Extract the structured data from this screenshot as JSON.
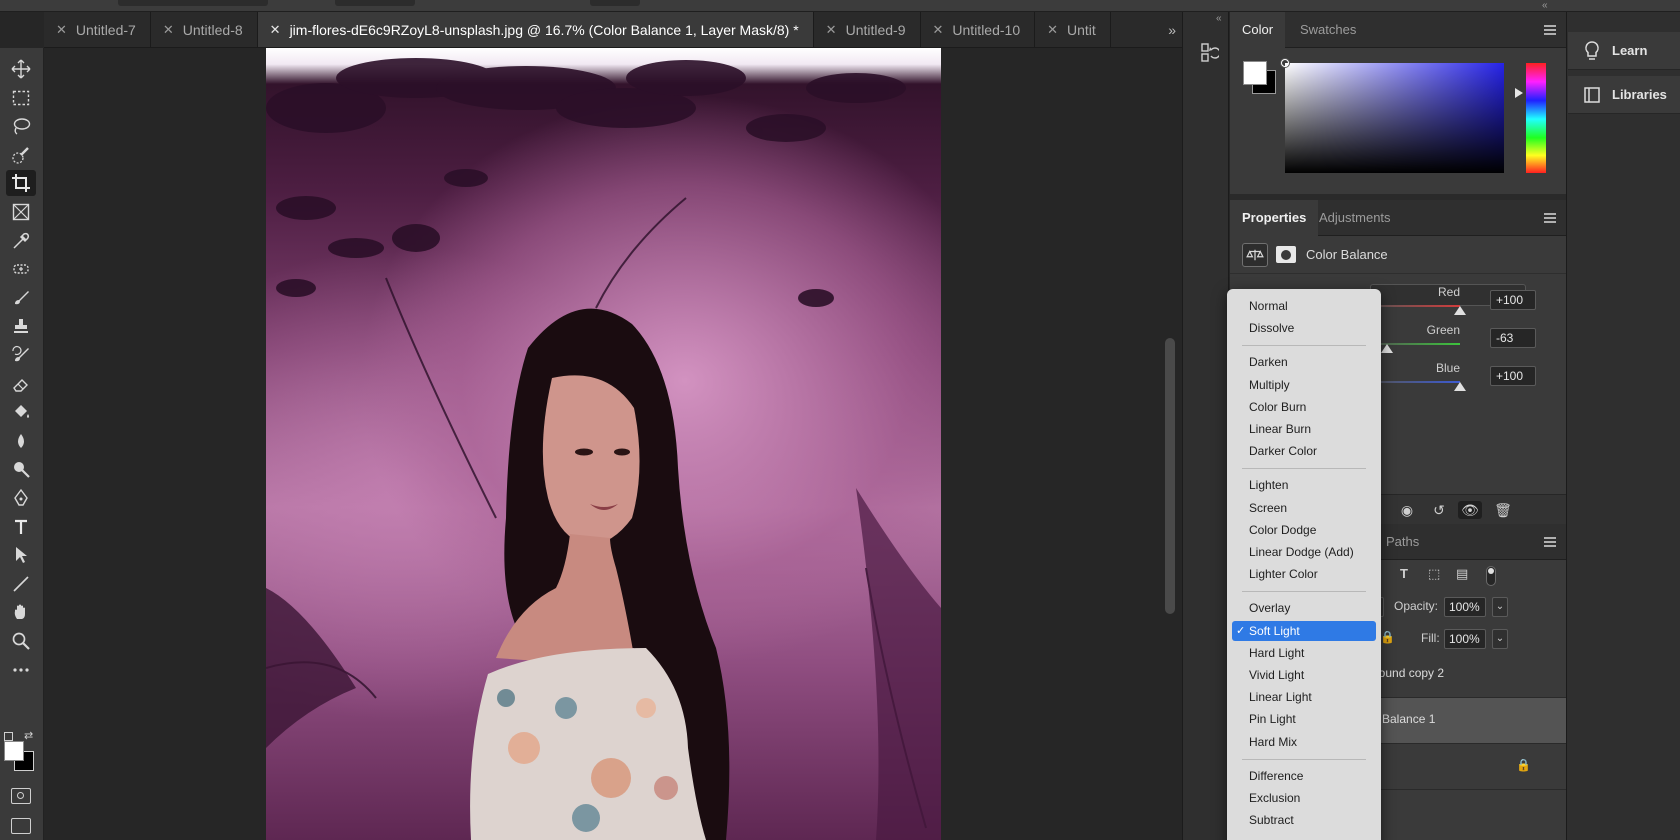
{
  "tabs": [
    {
      "label": "Untitled-7",
      "active": false
    },
    {
      "label": "Untitled-8",
      "active": false
    },
    {
      "label": "jim-flores-dE6c9RZoyL8-unsplash.jpg @ 16.7% (Color Balance 1, Layer Mask/8) *",
      "active": true
    },
    {
      "label": "Untitled-9",
      "active": false
    },
    {
      "label": "Untitled-10",
      "active": false
    },
    {
      "label": "Untit",
      "active": false
    }
  ],
  "tab_close_glyph": "✕",
  "tab_more_glyph": "»",
  "collapse_glyph": "«",
  "tools": [
    "move-icon",
    "marquee-icon",
    "lasso-icon",
    "quick-select-icon",
    "crop-icon",
    "frame-icon",
    "eyedropper-icon",
    "spot-healing-icon",
    "brush-icon",
    "clone-stamp-icon",
    "history-brush-icon",
    "eraser-icon",
    "paint-bucket-icon",
    "blur-icon",
    "dodge-icon",
    "pen-icon",
    "type-icon",
    "path-select-icon",
    "line-icon",
    "hand-icon",
    "zoom-icon",
    "more-tools-icon"
  ],
  "selected_tool": "crop-icon",
  "color_panel": {
    "tabs": [
      "Color",
      "Swatches"
    ],
    "active_tab": "Color",
    "foreground": "#ffffff",
    "background": "#000000",
    "picker_hue": "#2623e8"
  },
  "properties_panel": {
    "tabs": [
      "Properties",
      "Adjustments"
    ],
    "active_tab": "Properties",
    "adjustment_name": "Color Balance",
    "sliders": [
      {
        "label": "Red",
        "value": "+100",
        "level": 100,
        "color": "#d23c3c"
      },
      {
        "label": "Green",
        "value": "-63",
        "level": -63,
        "color": "#3cc43c"
      },
      {
        "label": "Blue",
        "value": "+100",
        "level": 100,
        "color": "#3c5ad2"
      }
    ],
    "preserve_fragment": "y"
  },
  "layers_panel": {
    "paths_tab": "Paths",
    "opacity_label": "Opacity:",
    "opacity_value": "100%",
    "fill_label": "Fill:",
    "fill_value": "100%",
    "layers": [
      {
        "name": "ground copy 2",
        "selected": false
      },
      {
        "name": "or Balance 1",
        "selected": true
      },
      {
        "name": "",
        "selected": false,
        "locked": true
      }
    ]
  },
  "far_right": {
    "learn": "Learn",
    "libraries": "Libraries"
  },
  "blend_menu": {
    "groups": [
      [
        "Normal",
        "Dissolve"
      ],
      [
        "Darken",
        "Multiply",
        "Color Burn",
        "Linear Burn",
        "Darker Color"
      ],
      [
        "Lighten",
        "Screen",
        "Color Dodge",
        "Linear Dodge (Add)",
        "Lighter Color"
      ],
      [
        "Overlay",
        "Soft Light",
        "Hard Light",
        "Vivid Light",
        "Linear Light",
        "Pin Light",
        "Hard Mix"
      ],
      [
        "Difference",
        "Exclusion",
        "Subtract"
      ]
    ],
    "selected": "Soft Light",
    "check_glyph": "✓"
  }
}
